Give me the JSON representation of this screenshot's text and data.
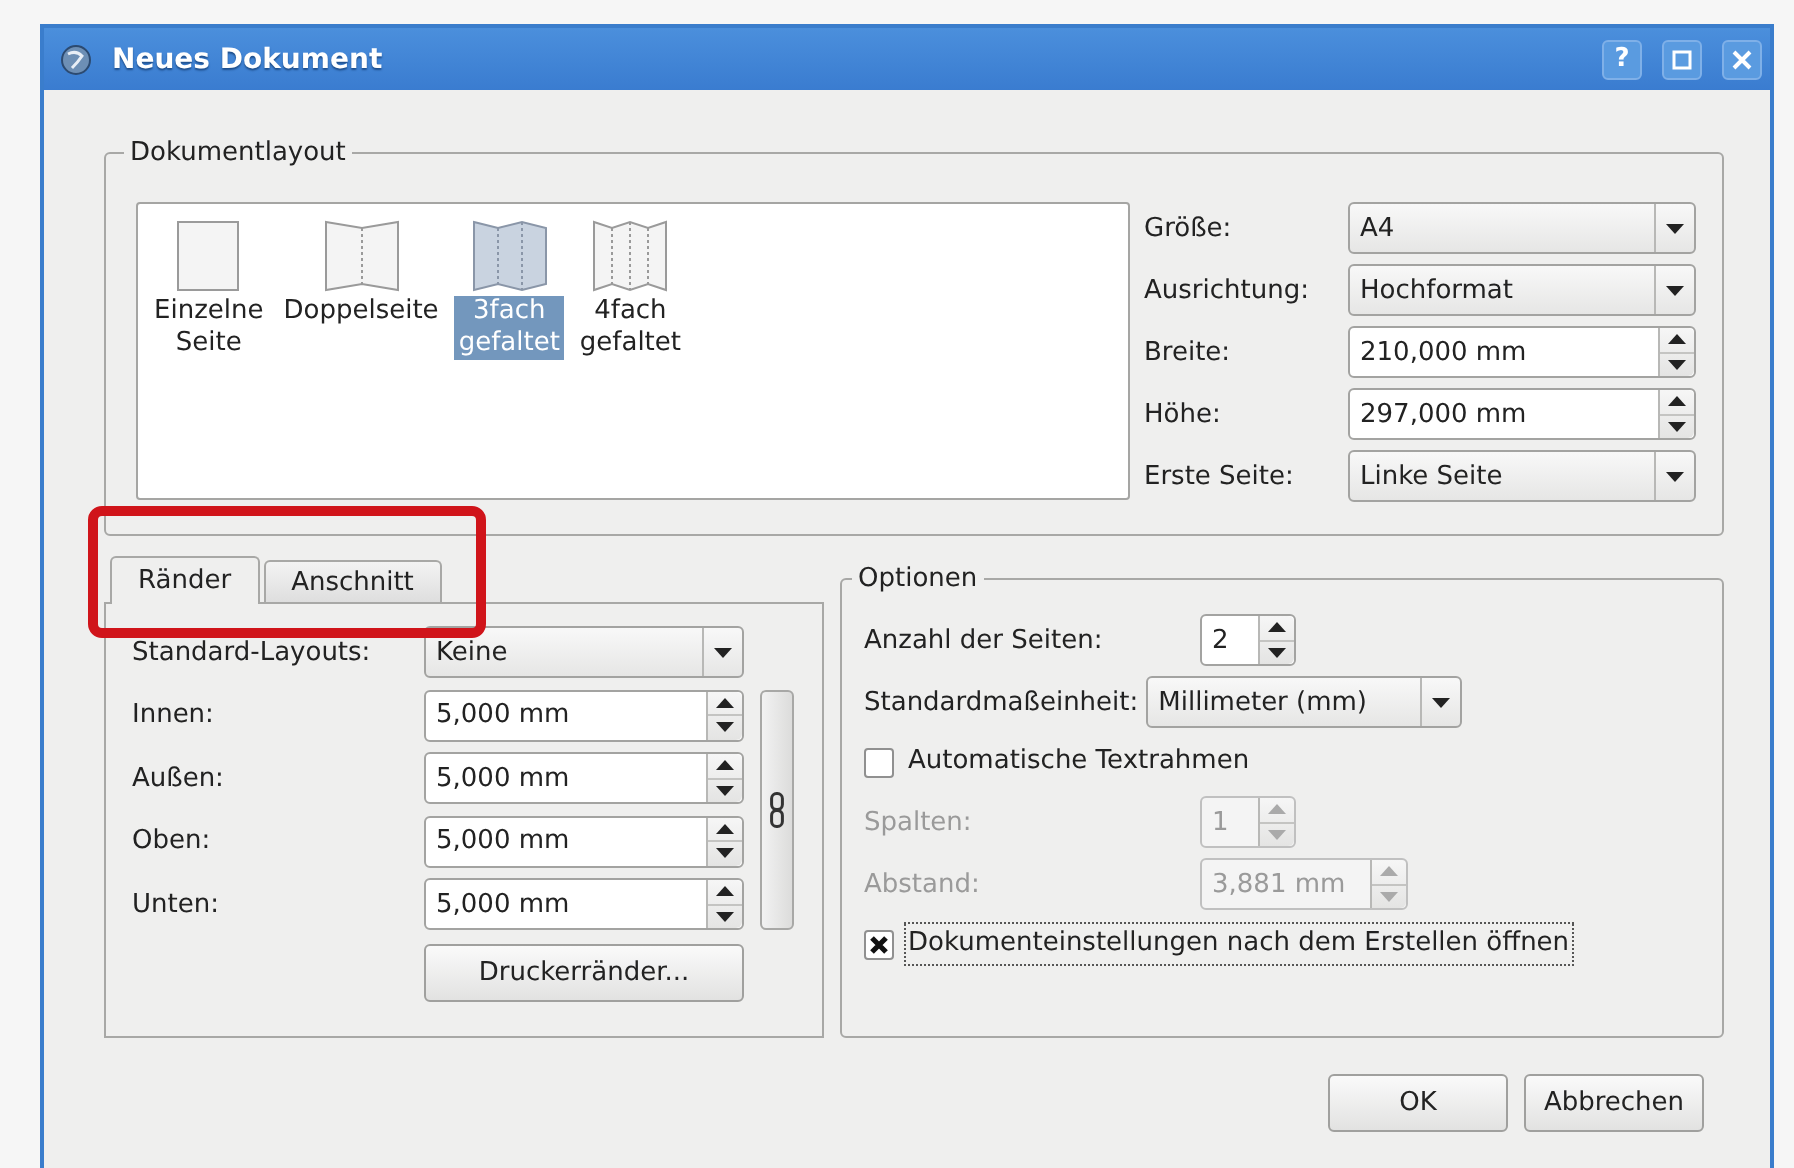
{
  "window": {
    "title": "Neues Dokument",
    "help": "?"
  },
  "layout_group": {
    "title": "Dokumentlayout",
    "layouts": [
      {
        "label": "Einzelne Seite",
        "kind": "single",
        "selected": false
      },
      {
        "label": "Doppelseite",
        "kind": "double",
        "selected": false
      },
      {
        "label": "3fach gefaltet",
        "kind": "triple",
        "selected": true
      },
      {
        "label": "4fach gefaltet",
        "kind": "quad",
        "selected": false
      }
    ],
    "fields": [
      {
        "label": "Größe:",
        "kind": "combo",
        "value": "A4"
      },
      {
        "label": "Ausrichtung:",
        "kind": "combo",
        "value": "Hochformat"
      },
      {
        "label": "Breite:",
        "kind": "spin",
        "value": "210,000 mm"
      },
      {
        "label": "Höhe:",
        "kind": "spin",
        "value": "297,000 mm"
      },
      {
        "label": "Erste Seite:",
        "kind": "combo",
        "value": "Linke Seite"
      }
    ]
  },
  "margin_tabs": [
    {
      "label": "Ränder",
      "selected": true
    },
    {
      "label": "Anschnitt",
      "selected": false
    }
  ],
  "margins": {
    "preset": {
      "label": "Standard-Layouts:",
      "value": "Keine"
    },
    "fields": [
      {
        "label": "Innen:",
        "value": "5,000 mm"
      },
      {
        "label": "Außen:",
        "value": "5,000 mm"
      },
      {
        "label": "Oben:",
        "value": "5,000 mm"
      },
      {
        "label": "Unten:",
        "value": "5,000 mm"
      }
    ],
    "button": "Druckerränder..."
  },
  "options": {
    "title": "Optionen",
    "rows": [
      {
        "kind": "spin",
        "label": "Anzahl der Seiten:",
        "value": "2",
        "disabled": false
      },
      {
        "kind": "combo",
        "label": "Standardmaßeinheit:",
        "value": "Millimeter (mm)",
        "disabled": false
      },
      {
        "kind": "check",
        "label": "Automatische Textrahmen",
        "checked": false,
        "disabled": false
      },
      {
        "kind": "spin",
        "label": "Spalten:",
        "value": "1",
        "disabled": true
      },
      {
        "kind": "spin",
        "label": "Abstand:",
        "value": "3,881 mm",
        "disabled": true
      },
      {
        "kind": "check",
        "label": "Dokumenteinstellungen nach dem Erstellen öffnen",
        "checked": true,
        "disabled": false
      }
    ]
  },
  "buttons": [
    "OK",
    "Abbrechen"
  ]
}
